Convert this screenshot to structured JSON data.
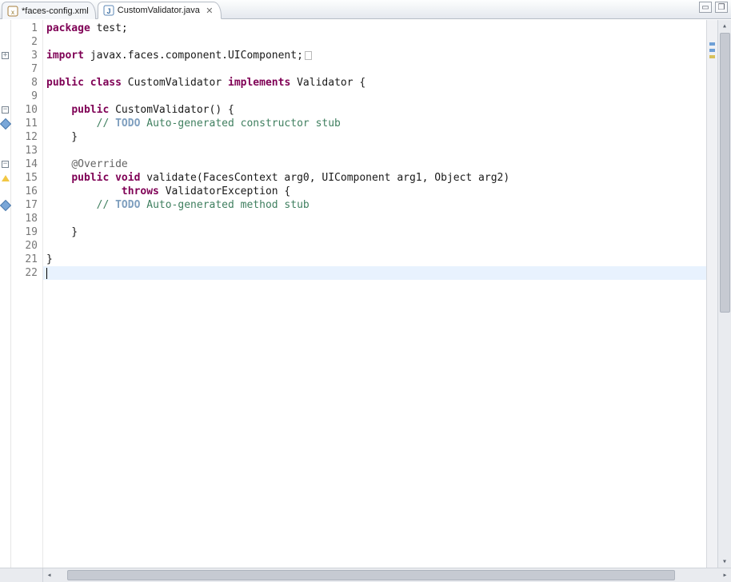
{
  "tabs": [
    {
      "label": "*faces-config.xml",
      "icon": "xml-icon"
    },
    {
      "label": "CustomValidator.java",
      "icon": "java-icon"
    }
  ],
  "active_tab_index": 1,
  "close_glyph": "✕",
  "win": {
    "min": "▭",
    "max": "❐"
  },
  "scroll": {
    "up": "▴",
    "down": "▾",
    "left": "◂",
    "right": "▸"
  },
  "code": {
    "line1": {
      "kw1": "package",
      "rest": " test;"
    },
    "line3": {
      "kw1": "import",
      "rest": " javax.faces.component.UIComponent;"
    },
    "line8": {
      "kw1": "public",
      "kw2": "class",
      "name": " CustomValidator ",
      "kw3": "implements",
      "iface": " Validator {"
    },
    "line10": {
      "kw1": "public",
      "rest": " CustomValidator() {"
    },
    "line11": {
      "pre": "        ",
      "cm": "// ",
      "todo": "TODO",
      "rest": " Auto-generated constructor stub"
    },
    "line12": {
      "txt": "    }"
    },
    "line14": {
      "ind": "    ",
      "ann": "@Override"
    },
    "line15": {
      "kw1": "public",
      "kw2": "void",
      "rest": " validate(FacesContext arg0, UIComponent arg1, Object arg2)"
    },
    "line16": {
      "ind": "            ",
      "kw1": "throws",
      "rest": " ValidatorException {"
    },
    "line17": {
      "pre": "        ",
      "cm": "// ",
      "todo": "TODO",
      "rest": " Auto-generated method stub"
    },
    "line19": {
      "txt": "    }"
    },
    "line21": {
      "txt": "}"
    }
  },
  "line_numbers": [
    "1",
    "2",
    "3",
    "7",
    "8",
    "9",
    "10",
    "11",
    "12",
    "13",
    "14",
    "15",
    "16",
    "17",
    "18",
    "19",
    "20",
    "21",
    "22"
  ],
  "markers": {
    "3": "fold-plus",
    "10": "fold-minus",
    "11": "info",
    "14": "fold-minus",
    "15": "warn",
    "17": "info"
  }
}
